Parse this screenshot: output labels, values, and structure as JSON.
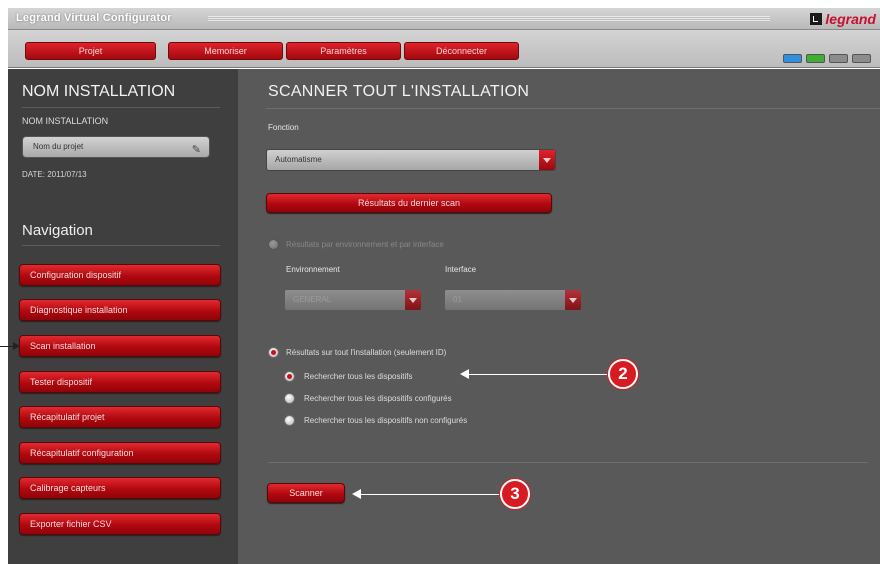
{
  "window": {
    "title": "Legrand Virtual Configurator",
    "brand": "legrand"
  },
  "menu": [
    {
      "label": "Projet"
    },
    {
      "label": "Memoriser"
    },
    {
      "label": "Paramètres"
    },
    {
      "label": "Déconnecter"
    }
  ],
  "window_buttons": [
    "#2f8fe0",
    "#3fae35",
    "#8c8c8c",
    "#8c8c8c"
  ],
  "sidebar": {
    "heading": "NOM INSTALLATION",
    "subheading": "NOM INSTALLATION",
    "project_value": "Nom du projet",
    "date": "DATE: 2011/07/13",
    "nav_heading": "Navigation",
    "nav_items": [
      {
        "label": "Configuration dispositif"
      },
      {
        "label": "Diagnostique installation"
      },
      {
        "label": "Scan installation"
      },
      {
        "label": "Tester dispositif"
      },
      {
        "label": "Récapitulatif projet"
      },
      {
        "label": "Récapitulatif configuration"
      },
      {
        "label": "Calibrage capteurs"
      },
      {
        "label": "Exporter fichier CSV"
      }
    ]
  },
  "main": {
    "title": "SCANNER TOUT L'INSTALLATION",
    "fonction_label": "Fonction",
    "fonction_value": "Automatisme",
    "last_scan_button": "Résultats du dernier scan",
    "option_env": "Résultats par environnement et par interface",
    "env_label": "Environnement",
    "env_value": "GENERAL",
    "interface_label": "Interface",
    "interface_value": "01",
    "option_all": "Résultats sur tout l'installation (seulement ID)",
    "sub_options": [
      {
        "label": "Rechercher tous les dispositifs"
      },
      {
        "label": "Rechercher tous les dispositifs configurés"
      },
      {
        "label": "Rechercher tous les dispositifs non configurés"
      }
    ],
    "scan_button": "Scanner"
  },
  "callouts": {
    "two": "2",
    "three": "3"
  },
  "colors": {
    "accent_red": "#c3101a",
    "sidebar_bg": "#3f3f3f",
    "main_bg": "#595959",
    "callout_red": "#d81a21"
  }
}
